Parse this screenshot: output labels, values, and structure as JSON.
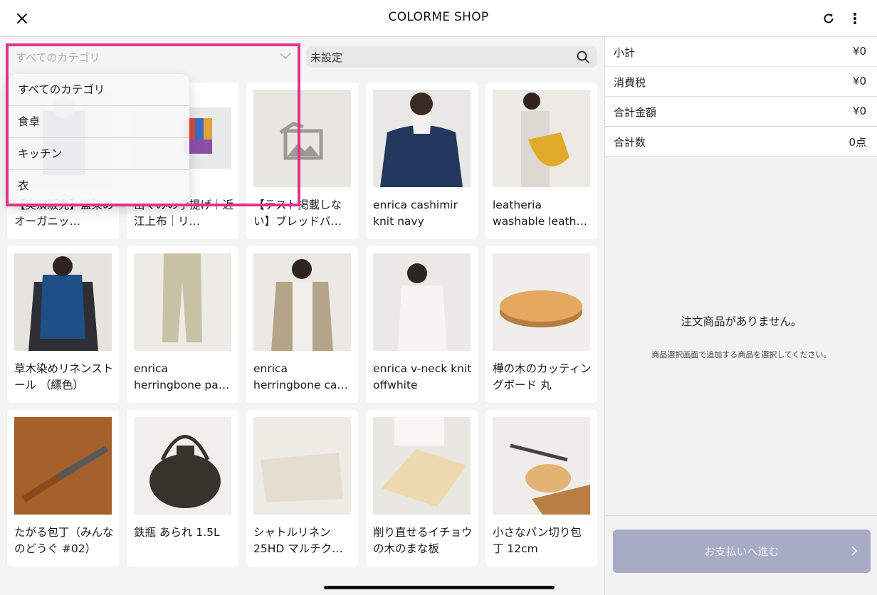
{
  "header": {
    "title": "COLORME SHOP"
  },
  "filter": {
    "category_placeholder": "すべてのカテゴリ",
    "search_value": "未設定"
  },
  "dropdown": {
    "options": [
      "すべてのカテゴリ",
      "食卓",
      "キッチン",
      "衣"
    ]
  },
  "products": [
    {
      "name": "【実演販売】藍染めオーガニッ…",
      "image": "indigo-product-photo"
    },
    {
      "name": "山ぐみの手提げ｜近江上布｜リ…",
      "image": "check-cloth-bag-photo"
    },
    {
      "name": "【テスト掲載しない】ブレッドバ…",
      "image": "placeholder-image-icon"
    },
    {
      "name": "enrica cashimir knit navy",
      "image": "navy-knit-photo"
    },
    {
      "name": "leatheria washable leath…",
      "image": "yellow-bag-photo"
    },
    {
      "name": "草木染めリネンストール （縹色）",
      "image": "blue-stole-photo"
    },
    {
      "name": "enrica herringbone pa…",
      "image": "herringbone-pants-photo"
    },
    {
      "name": "enrica herringbone ca…",
      "image": "herringbone-cardigan-photo"
    },
    {
      "name": "enrica v-neck knit offwhite",
      "image": "white-knit-photo"
    },
    {
      "name": "樺の木のカッティングボード 丸",
      "image": "round-board-photo"
    },
    {
      "name": "たがる包丁（みんなのどうぐ #02）",
      "image": "knife-photo"
    },
    {
      "name": "鉄瓶 あられ 1.5L",
      "image": "iron-kettle-photo"
    },
    {
      "name": "シャトルリネン 25HD マルチク…",
      "image": "linen-cloth-photo"
    },
    {
      "name": "削り直せるイチョウの木のまな板",
      "image": "ginkgo-board-photo"
    },
    {
      "name": "小さなパン切り包丁 12cm",
      "image": "bread-knife-photo"
    }
  ],
  "summary": {
    "subtotal_label": "小計",
    "subtotal_value": "¥0",
    "tax_label": "消費税",
    "tax_value": "¥0",
    "total_label": "合計金額",
    "total_value": "¥0",
    "count_label": "合計数",
    "count_value": "0点"
  },
  "cart": {
    "empty_title": "注文商品がありません。",
    "empty_sub": "商品選択画面で追加する商品を選択してください。"
  },
  "payment": {
    "label": "お支払いへ進む"
  },
  "colors": {
    "highlight": "#e0338a",
    "pay_button": "#a7abc4"
  }
}
